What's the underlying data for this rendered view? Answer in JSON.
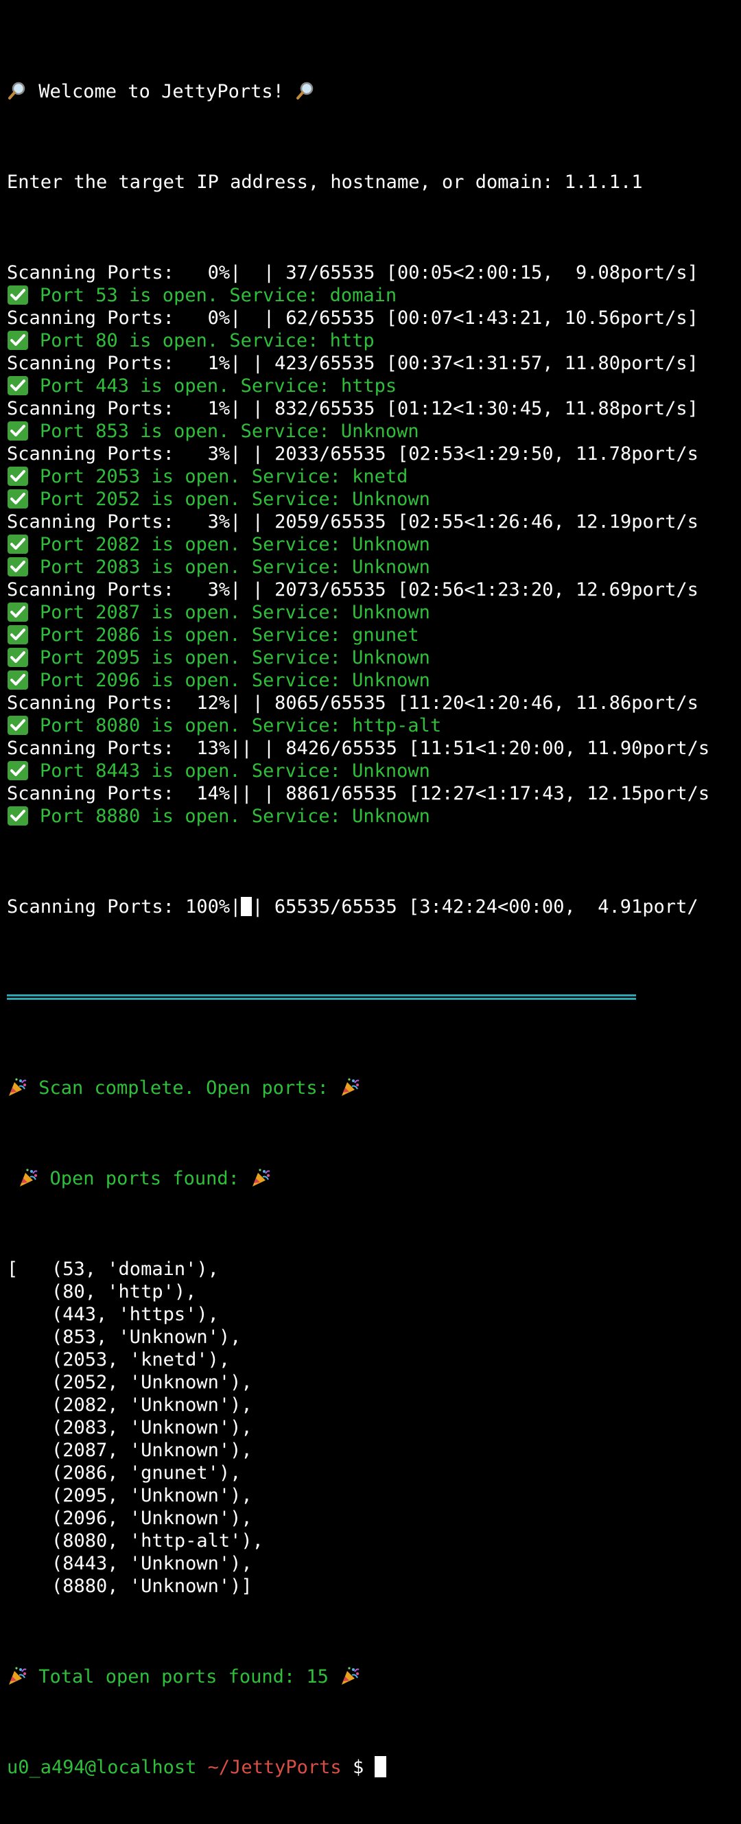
{
  "header": {
    "welcome": "Welcome to JettyPorts!",
    "target_prompt": "Enter the target IP address, hostname, or domain:",
    "target_value": "1.1.1.1"
  },
  "scan_log": [
    {
      "type": "progress",
      "text": "Scanning Ports:   0%|  | 37/65535 [00:05<2:00:15,  9.08port/s]"
    },
    {
      "type": "open",
      "text": "Port 53 is open. Service: domain"
    },
    {
      "type": "progress",
      "text": "Scanning Ports:   0%|  | 62/65535 [00:07<1:43:21, 10.56port/s]"
    },
    {
      "type": "open",
      "text": "Port 80 is open. Service: http"
    },
    {
      "type": "progress",
      "text": "Scanning Ports:   1%| | 423/65535 [00:37<1:31:57, 11.80port/s]"
    },
    {
      "type": "open",
      "text": "Port 443 is open. Service: https"
    },
    {
      "type": "progress",
      "text": "Scanning Ports:   1%| | 832/65535 [01:12<1:30:45, 11.88port/s]"
    },
    {
      "type": "open",
      "text": "Port 853 is open. Service: Unknown"
    },
    {
      "type": "progress",
      "text": "Scanning Ports:   3%| | 2033/65535 [02:53<1:29:50, 11.78port/s"
    },
    {
      "type": "open",
      "text": "Port 2053 is open. Service: knetd"
    },
    {
      "type": "open",
      "text": "Port 2052 is open. Service: Unknown"
    },
    {
      "type": "progress",
      "text": "Scanning Ports:   3%| | 2059/65535 [02:55<1:26:46, 12.19port/s"
    },
    {
      "type": "open",
      "text": "Port 2082 is open. Service: Unknown"
    },
    {
      "type": "open",
      "text": "Port 2083 is open. Service: Unknown"
    },
    {
      "type": "progress",
      "text": "Scanning Ports:   3%| | 2073/65535 [02:56<1:23:20, 12.69port/s"
    },
    {
      "type": "open",
      "text": "Port 2087 is open. Service: Unknown"
    },
    {
      "type": "open",
      "text": "Port 2086 is open. Service: gnunet"
    },
    {
      "type": "open",
      "text": "Port 2095 is open. Service: Unknown"
    },
    {
      "type": "open",
      "text": "Port 2096 is open. Service: Unknown"
    },
    {
      "type": "progress",
      "text": "Scanning Ports:  12%| | 8065/65535 [11:20<1:20:46, 11.86port/s"
    },
    {
      "type": "open",
      "text": "Port 8080 is open. Service: http-alt"
    },
    {
      "type": "progress",
      "text": "Scanning Ports:  13%|| | 8426/65535 [11:51<1:20:00, 11.90port/s"
    },
    {
      "type": "open",
      "text": "Port 8443 is open. Service: Unknown"
    },
    {
      "type": "progress",
      "text": "Scanning Ports:  14%|| | 8861/65535 [12:27<1:17:43, 12.15port/s"
    },
    {
      "type": "open",
      "text": "Port 8880 is open. Service: Unknown"
    }
  ],
  "final_progress": {
    "prefix": "Scanning Ports: 100%|",
    "suffix": "| 65535/65535 [3:42:24<00:00,  4.91port/"
  },
  "summary": {
    "scan_complete": "Scan complete. Open ports:",
    "open_ports_found": "Open ports found:",
    "ports_list": [
      "[   (53, 'domain'),",
      "    (80, 'http'),",
      "    (443, 'https'),",
      "    (853, 'Unknown'),",
      "    (2053, 'knetd'),",
      "    (2052, 'Unknown'),",
      "    (2082, 'Unknown'),",
      "    (2083, 'Unknown'),",
      "    (2087, 'Unknown'),",
      "    (2086, 'gnunet'),",
      "    (2095, 'Unknown'),",
      "    (2096, 'Unknown'),",
      "    (8080, 'http-alt'),",
      "    (8443, 'Unknown'),",
      "    (8880, 'Unknown')]"
    ],
    "total": "Total open ports found: 15"
  },
  "prompt": {
    "user_host": "u0_a494@localhost",
    "path": "~/JettyPorts",
    "symbol": "$"
  },
  "icons": {
    "search": "magnifying-glass-icon",
    "check": "check-mark-icon",
    "party": "party-popper-icon"
  },
  "colors": {
    "background": "#000000",
    "text": "#ffffff",
    "success_green": "#2fbf3a",
    "separator_cyan": "#2aa6b6",
    "path_red": "#d94f43"
  }
}
